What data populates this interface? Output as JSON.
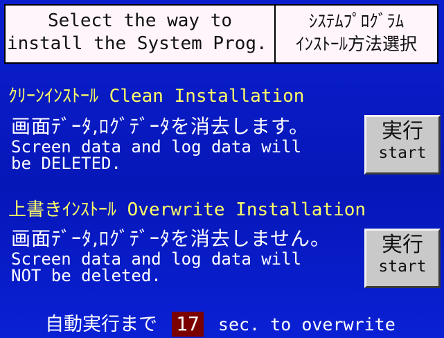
{
  "header": {
    "en_line1": "Select the way to",
    "en_line2": "install the System Prog.",
    "jp_line1": "ｼｽﾃﾑﾌﾟﾛｸﾞﾗﾑ",
    "jp_line2": "ｲﾝｽﾄｰﾙ方法選択"
  },
  "clean": {
    "title": "ｸﾘｰﾝｲﾝｽﾄｰﾙ Clean Installation",
    "desc_jp": "画面ﾃﾞｰﾀ,ﾛｸﾞﾃﾞｰﾀを消去します。",
    "desc_en1": "Screen data and log data will",
    "desc_en2": "be DELETED.",
    "button_jp": "実行",
    "button_en": "start"
  },
  "overwrite": {
    "title": "上書きｲﾝｽﾄｰﾙ Overwrite Installation",
    "desc_jp": "画面ﾃﾞｰﾀ,ﾛｸﾞﾃﾞｰﾀを消去しません。",
    "desc_en1": "Screen data and log data will",
    "desc_en2": "NOT be deleted.",
    "button_jp": "実行",
    "button_en": "start"
  },
  "footer": {
    "prefix_jp": "自動実行まで",
    "countdown": "17",
    "suffix": "sec. to overwrite"
  },
  "colors": {
    "background": "#0b1fcf",
    "title_text": "#ffff66",
    "body_text": "#ffffff",
    "countdown_bg": "#7a0000",
    "button_face": "#c9c9c9"
  }
}
